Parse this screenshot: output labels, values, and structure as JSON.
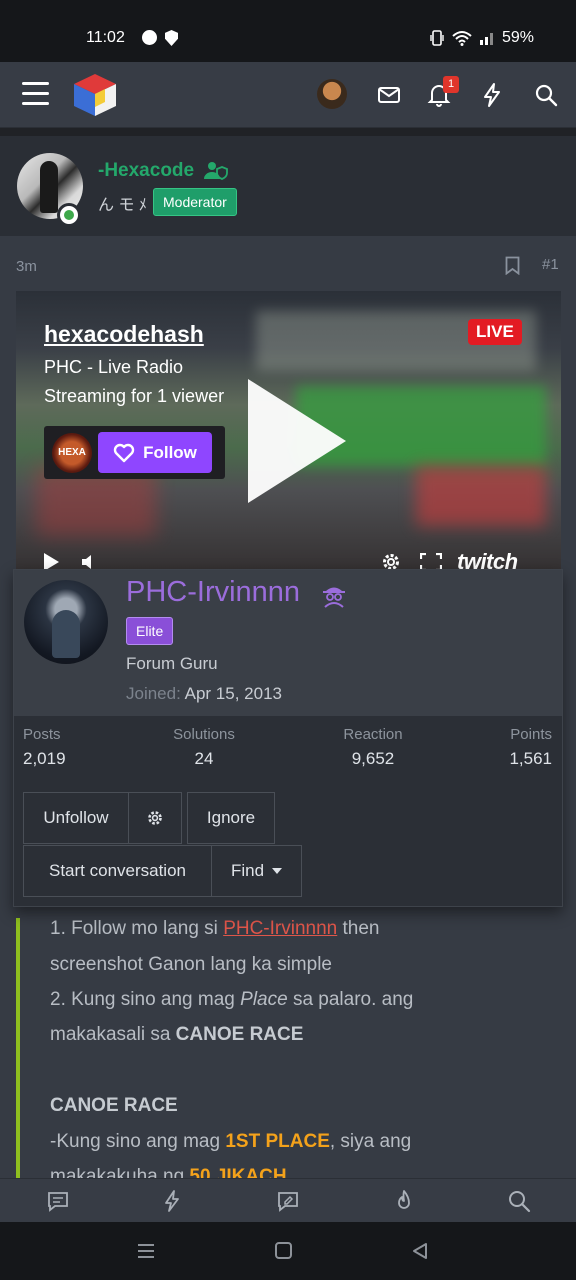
{
  "status_bar": {
    "time": "11:02",
    "battery": "59%"
  },
  "header": {
    "notification_count": "1"
  },
  "post": {
    "author": "-Hexacode",
    "author_title": "ん モ ﾒ",
    "author_badge": "Moderator",
    "time": "3m",
    "number": "#1"
  },
  "embed": {
    "channel": "hexacodehash",
    "stream_title": "PHC - Live Radio",
    "viewers": "Streaming for 1 viewer",
    "live_label": "LIVE",
    "follow_label": "Follow",
    "avatar_text": "HEXA",
    "twitch_logo": "twitch"
  },
  "member_card": {
    "name": "PHC-Irvinnnn",
    "badge": "Elite",
    "rank": "Forum Guru",
    "joined_label": "Joined:",
    "joined_date": "Apr 15, 2013",
    "stats": [
      {
        "label": "Posts",
        "value": "2,019"
      },
      {
        "label": "Solutions",
        "value": "24"
      },
      {
        "label": "Reaction",
        "value": "9,652"
      },
      {
        "label": "Points",
        "value": "1,561"
      }
    ],
    "buttons": {
      "unfollow": "Unfollow",
      "ignore": "Ignore",
      "start_conversation": "Start conversation",
      "find": "Find"
    }
  },
  "post_text": {
    "line1_prefix": "1. Follow mo lang si ",
    "line1_link": "PHC-Irvinnnn",
    "line1_suffix": " then",
    "line2": "screenshot Ganon lang ka simple",
    "line3_prefix": "2. Kung sino ang mag ",
    "line3_italic": "Place",
    "line3_suffix": " sa palaro. ang",
    "line4_prefix": "makakasali sa ",
    "line4_bold": "CANOE RACE",
    "line5_bold": "CANOE RACE",
    "line6_prefix": "-Kung sino ang mag ",
    "line6_highlight": "1ST PLACE",
    "line6_suffix": ", siya ang",
    "line7_prefix": "makakakuha ng ",
    "line7_highlight": "50 JIKACH"
  },
  "colors": {
    "accent_green": "#24a86b",
    "elite_purple": "#8a4fd8",
    "live_red": "#e31b23",
    "twitch_purple": "#8f46ff",
    "link_red": "#e0564a",
    "highlight_orange": "#f4a21b"
  }
}
